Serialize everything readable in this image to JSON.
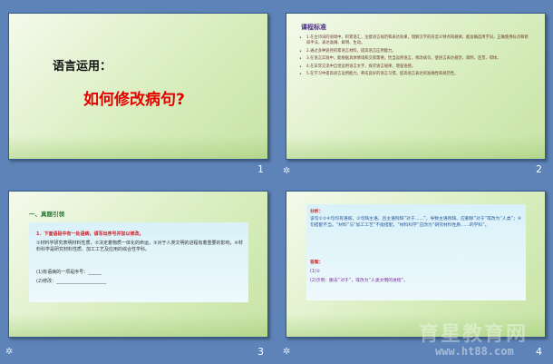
{
  "slides": [
    {
      "number": "1",
      "subtitle": "语言运用：",
      "title": "如何修改病句?"
    },
    {
      "number": "2",
      "heading": "课程标准",
      "items": [
        "1.在古诗词的语境中，积累语汇，注意语言规范和表达效果，理解汉字的形音义特点和规律，能准确选用字词，正确使用标点和修辞手法，表达准确、鲜明、生动。",
        "2.通过多种途径积累语言材料，提高语言应用能力。",
        "3.在语言实践中，能根据具体情境和交际需要，恰当运用语言，修改病句，使语言表达规范、简明、连贯、得体。",
        "4.在日常交流中自觉运用语言文字，探究语言规律，增强语感。",
        "5.在学习中提高语言运用能力，养成良好的语言习惯，提高语言表达的准确性和规范性。"
      ]
    },
    {
      "number": "3",
      "heading": "一、真题引领",
      "question": "1．下面语段中有一处语病，请写出序号并加以修改。",
      "passage": "①材料学研究表明材料性质，②决定着物质一体化的命运，③对于人类文明的进程有着重要的影响，④材料科学是研究材料性质、加工工艺及应用的综合性学科。",
      "answer_1": "(1)有语病的一项是序号：______",
      "answer_2": "(2)修改：______________________"
    },
    {
      "number": "4",
      "analysis_label": "分析：",
      "analysis_text": "该句①②④句均有语病，②句缺主语，且主语残缺“对于……”，导致主语残缺。应删除“对于”或改为“人类”；④句搭配不当，“材料”与“加工工艺”不能搭配，“材料科学”应改为“研究材料性质……的学科”。",
      "answer_label": "答案：",
      "answer_1": "(1)②",
      "answer_2": "(2)示例：删去“对于”，或改为“人类文明的进程”。"
    }
  ],
  "watermark": {
    "text": "育星教育网",
    "url": "www.ht88.com"
  }
}
